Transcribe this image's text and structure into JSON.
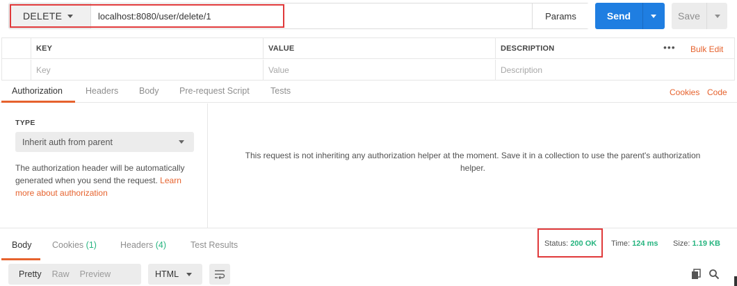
{
  "request": {
    "method": "DELETE",
    "url": "localhost:8080/user/delete/1",
    "params_label": "Params",
    "send_label": "Send",
    "save_label": "Save"
  },
  "params_table": {
    "headers": [
      "KEY",
      "VALUE",
      "DESCRIPTION"
    ],
    "placeholders": {
      "key": "Key",
      "value": "Value",
      "description": "Description"
    },
    "more_label": "•••",
    "bulk_edit_label": "Bulk Edit"
  },
  "request_tabs": {
    "items": [
      "Authorization",
      "Headers",
      "Body",
      "Pre-request Script",
      "Tests"
    ],
    "active": "Authorization",
    "cookies_link": "Cookies",
    "code_link": "Code"
  },
  "authorization": {
    "type_label": "TYPE",
    "type_value": "Inherit auth from parent",
    "note": "The authorization header will be automatically generated when you send the request.",
    "note_link": "Learn more about authorization",
    "message": "This request is not inheriting any authorization helper at the moment. Save it in a collection to use the parent's authorization helper."
  },
  "response_tabs": {
    "body": "Body",
    "cookies": "Cookies",
    "cookies_count": "(1)",
    "headers": "Headers",
    "headers_count": "(4)",
    "test_results": "Test Results"
  },
  "response_meta": {
    "status_label": "Status:",
    "status_value": "200 OK",
    "time_label": "Time:",
    "time_value": "124 ms",
    "size_label": "Size:",
    "size_value": "1.19 KB"
  },
  "response_toolbar": {
    "view_modes": [
      "Pretty",
      "Raw",
      "Preview"
    ],
    "active_mode": "Pretty",
    "format": "HTML"
  },
  "colors": {
    "accent": "#e6622d",
    "send": "#1f7ee1",
    "success": "#26b47f",
    "highlight": "#e0393a"
  },
  "icons": [
    "chevron-down-icon",
    "wrap-lines-icon",
    "copy-icon",
    "search-icon"
  ]
}
